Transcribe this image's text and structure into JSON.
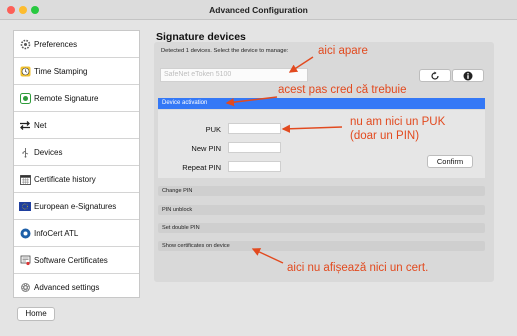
{
  "window": {
    "title": "Advanced Configuration"
  },
  "sidebar": {
    "items": [
      {
        "label": "Preferences",
        "icon": "gear-icon"
      },
      {
        "label": "Time Stamping",
        "icon": "clock-icon"
      },
      {
        "label": "Remote Signature",
        "icon": "remote-signature-icon"
      },
      {
        "label": "Net",
        "icon": "net-arrows-icon"
      },
      {
        "label": "Devices",
        "icon": "usb-icon"
      },
      {
        "label": "Certificate history",
        "icon": "calendar-icon"
      },
      {
        "label": "European e-Signatures",
        "icon": "eu-flag-icon"
      },
      {
        "label": "InfoCert ATL",
        "icon": "infocert-icon"
      },
      {
        "label": "Software Certificates",
        "icon": "certificate-icon"
      },
      {
        "label": "Advanced settings",
        "icon": "advanced-settings-icon"
      }
    ]
  },
  "home_label": "Home",
  "main": {
    "heading": "Signature devices",
    "detected": "Detected 1 devices. Select the device to manage:",
    "device_value": "SafeNet eToken 5100",
    "activation": {
      "title": "Device activation",
      "puk_label": "PUK",
      "new_pin_label": "New PIN",
      "repeat_pin_label": "Repeat PIN",
      "confirm_label": "Confirm"
    },
    "sections": [
      "Change PIN",
      "PIN unblock",
      "Set double PIN",
      "Show certificates on device"
    ]
  },
  "annotations": {
    "a1": "aici apare",
    "a2": "acest pas cred că trebuie",
    "a3_line1": "nu am nici un PUK",
    "a3_line2": "(doar un PIN)",
    "a4": "aici nu afișează nici un cert."
  },
  "colors": {
    "accent": "#3478f6",
    "annotation": "#e24a1f"
  }
}
